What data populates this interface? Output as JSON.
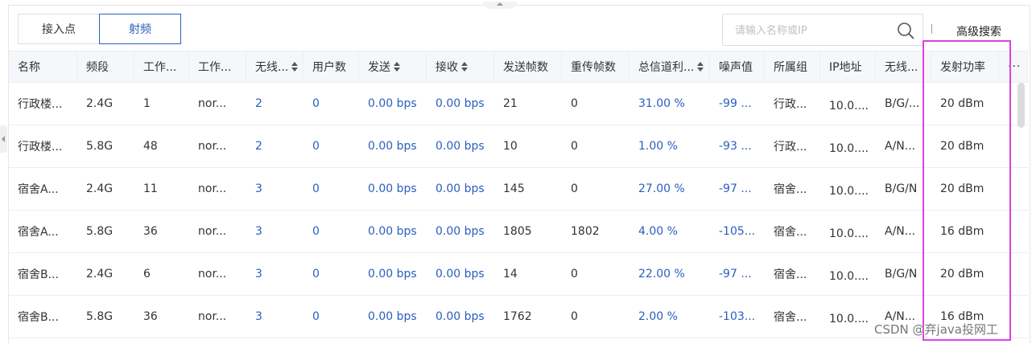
{
  "tabs": [
    {
      "label": "接入点",
      "active": false
    },
    {
      "label": "射频",
      "active": true
    }
  ],
  "search": {
    "placeholder": "请输入名称或IP",
    "value": ""
  },
  "advanced_search_label": "高级搜索",
  "columns": [
    {
      "label": "名称",
      "sortable": false
    },
    {
      "label": "频段",
      "sortable": false
    },
    {
      "label": "工作...",
      "sortable": false
    },
    {
      "label": "工作...",
      "sortable": false
    },
    {
      "label": "无线...",
      "sortable": true
    },
    {
      "label": "用户数",
      "sortable": false
    },
    {
      "label": "发送",
      "sortable": true
    },
    {
      "label": "接收",
      "sortable": true
    },
    {
      "label": "发送帧数",
      "sortable": false
    },
    {
      "label": "重传帧数",
      "sortable": false
    },
    {
      "label": "总信道利...",
      "sortable": true
    },
    {
      "label": "噪声值",
      "sortable": false
    },
    {
      "label": "所属组",
      "sortable": false
    },
    {
      "label": "IP地址",
      "sortable": false
    },
    {
      "label": "无线...",
      "sortable": false
    },
    {
      "label": "发射功率",
      "sortable": false
    }
  ],
  "more_columns": "···",
  "rows": [
    [
      "行政楼...",
      "2.4G",
      "1",
      "nor...",
      "2",
      "0",
      "0.00 bps",
      "0.00 bps",
      "21",
      "0",
      "31.00 %",
      "-99 ...",
      "行政...",
      "10.0....",
      "B/G/...",
      "20 dBm"
    ],
    [
      "行政楼...",
      "5.8G",
      "48",
      "nor...",
      "2",
      "0",
      "0.00 bps",
      "0.00 bps",
      "10",
      "0",
      "1.00 %",
      "-93 ...",
      "行政...",
      "10.0....",
      "A/N...",
      "20 dBm"
    ],
    [
      "宿舍A...",
      "2.4G",
      "11",
      "nor...",
      "3",
      "0",
      "0.00 bps",
      "0.00 bps",
      "145",
      "0",
      "27.00 %",
      "-97 ...",
      "宿舍...",
      "10.0....",
      "B/G/N",
      "20 dBm"
    ],
    [
      "宿舍A...",
      "5.8G",
      "36",
      "nor...",
      "3",
      "0",
      "0.00 bps",
      "0.00 bps",
      "1805",
      "1802",
      "4.00 %",
      "-105...",
      "宿舍...",
      "10.0....",
      "A/N...",
      "16 dBm"
    ],
    [
      "宿舍B...",
      "2.4G",
      "6",
      "nor...",
      "3",
      "0",
      "0.00 bps",
      "0.00 bps",
      "14",
      "0",
      "22.00 %",
      "-97 ...",
      "宿舍...",
      "10.0....",
      "B/G/N",
      "20 dBm"
    ],
    [
      "宿舍B...",
      "5.8G",
      "36",
      "nor...",
      "3",
      "0",
      "0.00 bps",
      "0.00 bps",
      "1762",
      "0",
      "2.00 %",
      "-103...",
      "宿舍...",
      "10.0....",
      "A/N...",
      "16 dBm"
    ]
  ],
  "watermark": "CSDN @弃java投网工",
  "colors": {
    "accent": "#2a5ebf",
    "highlight": "#e040e0"
  }
}
